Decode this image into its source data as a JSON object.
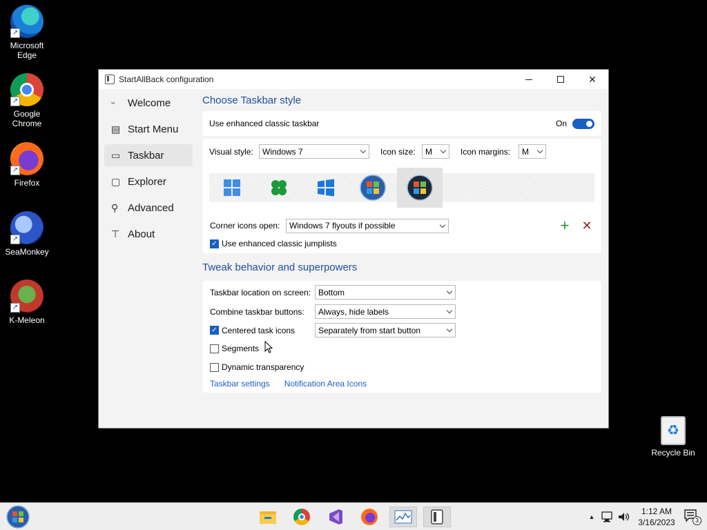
{
  "desktop": {
    "icons": [
      {
        "label_line1": "Microsoft",
        "label_line2": "Edge",
        "icon": "edge-icon"
      },
      {
        "label_line1": "Google",
        "label_line2": "Chrome",
        "icon": "chrome-icon"
      },
      {
        "label_line1": "Firefox",
        "label_line2": "",
        "icon": "firefox-icon"
      },
      {
        "label_line1": "SeaMonkey",
        "label_line2": "",
        "icon": "seamonkey-icon"
      },
      {
        "label_line1": "K-Meleon",
        "label_line2": "",
        "icon": "k-meleon-icon"
      },
      {
        "label_line1": "Recycle Bin",
        "label_line2": "",
        "icon": "recycle-bin-icon"
      }
    ]
  },
  "window": {
    "title": "StartAllBack configuration",
    "controls": {
      "minimize": "minimize-icon",
      "maximize": "maximize-icon",
      "close": "close-icon",
      "close_glyph": "✕"
    }
  },
  "sidebar": {
    "items": [
      {
        "label": "Welcome",
        "icon": "smiley-icon",
        "glyph": "ᵕ"
      },
      {
        "label": "Start Menu",
        "icon": "start-menu-icon",
        "glyph": "▤"
      },
      {
        "label": "Taskbar",
        "icon": "taskbar-icon",
        "glyph": "▭"
      },
      {
        "label": "Explorer",
        "icon": "explorer-icon",
        "glyph": "▢"
      },
      {
        "label": "Advanced",
        "icon": "wrench-icon",
        "glyph": "⚲"
      },
      {
        "label": "About",
        "icon": "about-icon",
        "glyph": "⊤"
      }
    ],
    "active_index": 2
  },
  "taskbar_style": {
    "heading": "Choose Taskbar style",
    "enhanced_label": "Use enhanced classic taskbar",
    "enhanced_state": "On",
    "visual_style_label": "Visual style:",
    "visual_style_value": "Windows 7",
    "icon_size_label": "Icon size:",
    "icon_size_value": "M",
    "icon_margins_label": "Icon margins:",
    "icon_margins_value": "M",
    "styles": [
      "windows-11-icon",
      "clover-icon",
      "windows-10-icon",
      "windows-7-orb-icon",
      "windows-vista-orb-icon"
    ],
    "selected_style": 4,
    "corner_icons_label": "Corner icons open:",
    "corner_icons_value": "Windows 7 flyouts if possible",
    "add_glyph": "+",
    "remove_glyph": "✕",
    "jumplists_label": "Use enhanced classic jumplists",
    "jumplists_checked": true
  },
  "tweaks": {
    "heading": "Tweak behavior and superpowers",
    "location_label": "Taskbar location on screen:",
    "location_value": "Bottom",
    "combine_label": "Combine taskbar buttons:",
    "combine_value": "Always, hide labels",
    "centered_label": "Centered task icons",
    "centered_checked": true,
    "centered_value": "Separately from start button",
    "segments_label": "Segments",
    "segments_checked": false,
    "transparency_label": "Dynamic transparency",
    "transparency_checked": false,
    "link_taskbar_settings": "Taskbar settings",
    "link_notification_icons": "Notification Area Icons",
    "check_glyph": "✓"
  },
  "taskbar": {
    "start_icon": "start-orb-icon",
    "apps": [
      "file-explorer-icon",
      "chrome-icon",
      "visual-studio-icon",
      "firefox-icon",
      "performance-monitor-icon",
      "startallback-icon"
    ],
    "active_apps": [
      4,
      5
    ],
    "tray_up_glyph": "▲",
    "time": "1:12 AM",
    "date": "3/16/2023",
    "notification_count": "3"
  },
  "colors": {
    "accent": "#1a5fc2",
    "heading": "#1c4f9b",
    "add": "#2a8a2a",
    "remove": "#8a2a2a"
  }
}
